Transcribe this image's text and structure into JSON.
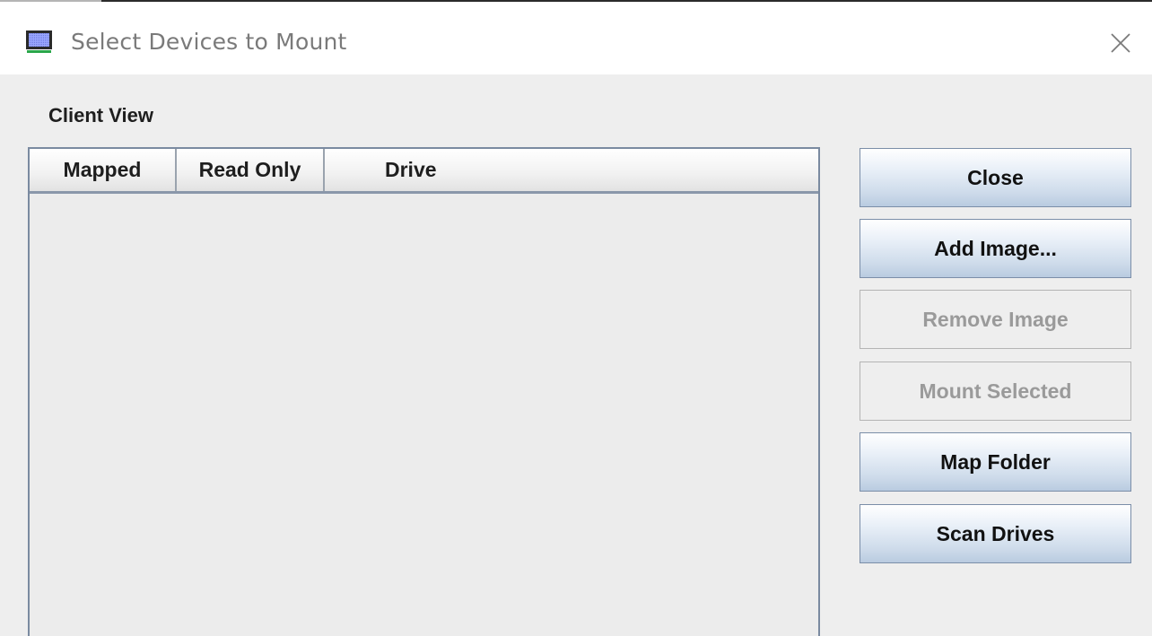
{
  "window": {
    "title": "Select Devices to Mount"
  },
  "client_view": {
    "label": "Client View",
    "columns": [
      "Mapped",
      "Read Only",
      "Drive"
    ],
    "rows": []
  },
  "buttons": {
    "close": {
      "label": "Close",
      "enabled": true
    },
    "add_image": {
      "label": "Add Image...",
      "enabled": true
    },
    "remove_image": {
      "label": "Remove Image",
      "enabled": false
    },
    "mount_selected": {
      "label": "Mount Selected",
      "enabled": false
    },
    "map_folder": {
      "label": "Map Folder",
      "enabled": true
    },
    "scan_drives": {
      "label": "Scan Drives",
      "enabled": true
    }
  },
  "icons": {
    "app": "monitor-icon",
    "close": "close-icon"
  },
  "colors": {
    "button_gradient_top": "#ffffff",
    "button_gradient_bottom": "#b9cbe0",
    "button_border": "#7b8ea8",
    "disabled_text": "#9a9a9a",
    "background": "#eeeeee"
  }
}
